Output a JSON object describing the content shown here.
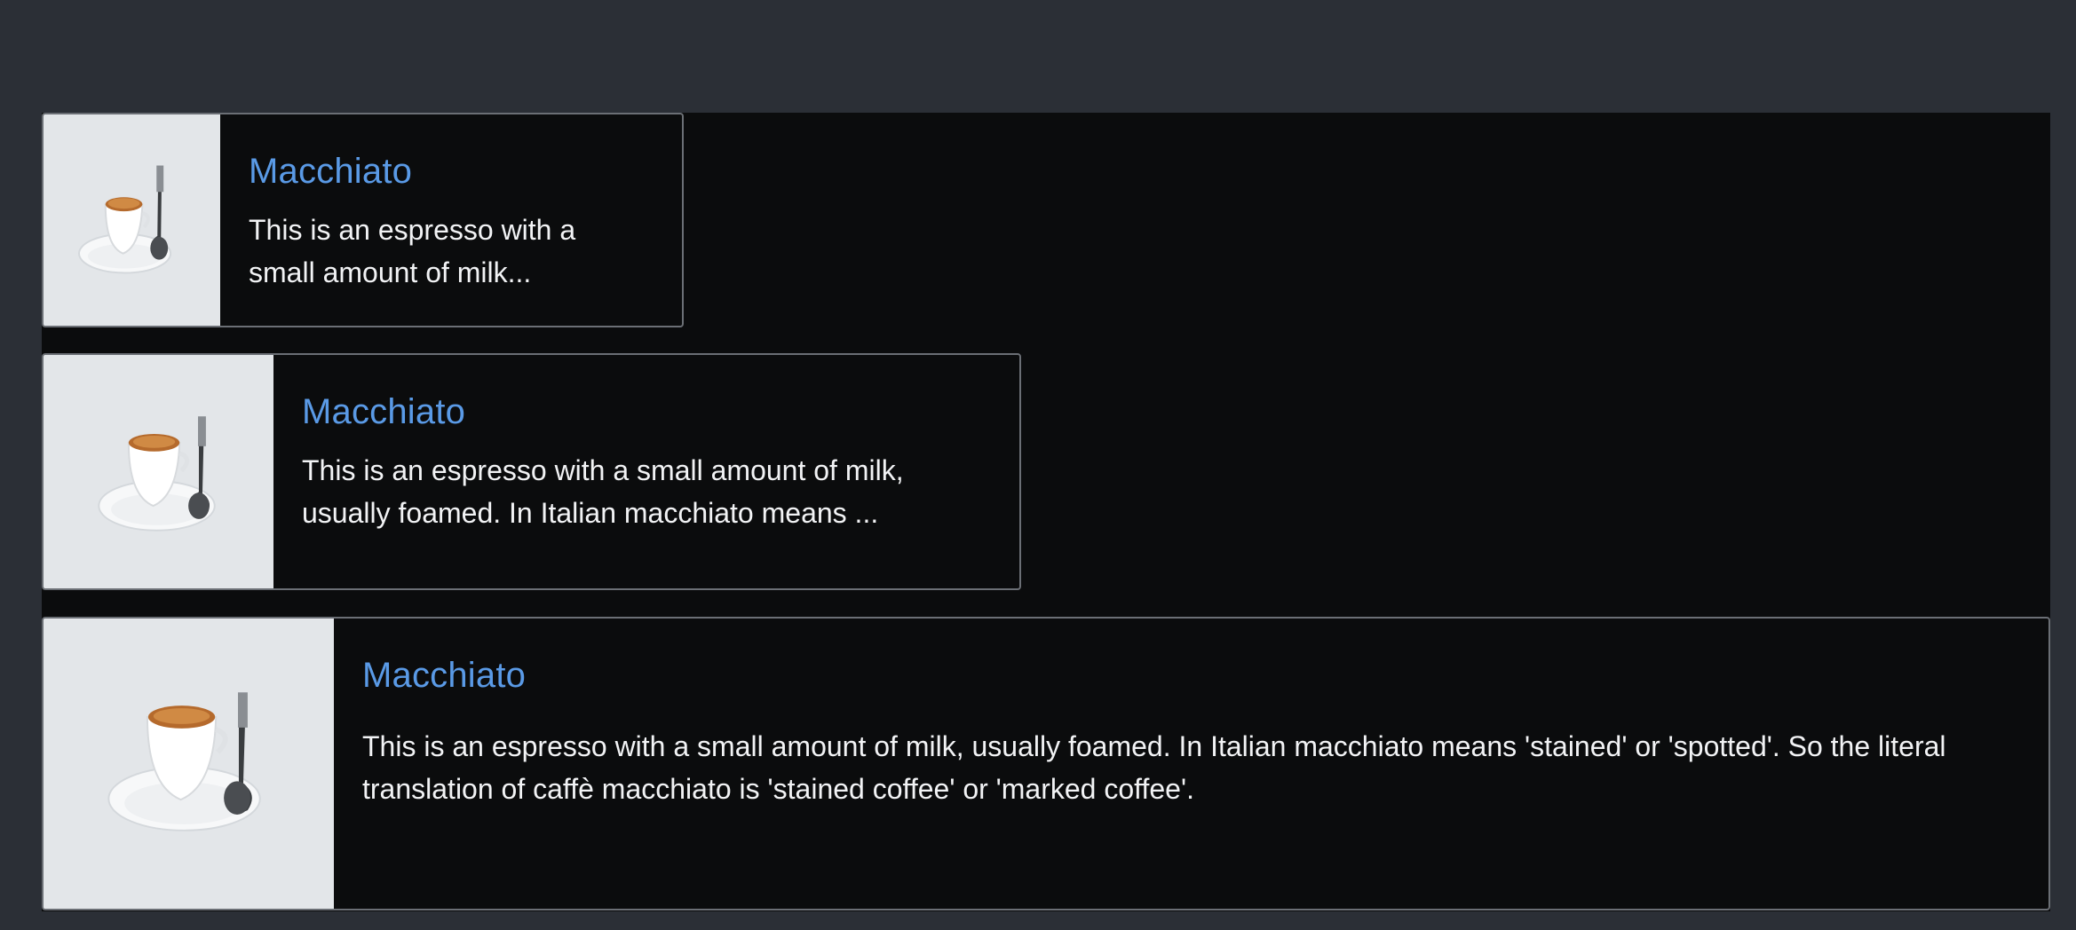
{
  "cards": [
    {
      "title": "Macchiato",
      "text": "This is an espresso with a small amount of milk...",
      "image": "coffee-cup-image"
    },
    {
      "title": "Macchiato",
      "text": "This is an espresso with a small amount of milk, usually foamed. In Italian macchiato means ...",
      "image": "coffee-cup-image"
    },
    {
      "title": "Macchiato",
      "text": "This is an espresso with a small amount of milk, usually foamed. In Italian macchiato means 'stained' or 'spotted'. So the literal translation of caffè macchiato is 'stained coffee' or 'marked coffee'.",
      "image": "coffee-cup-image"
    }
  ],
  "colors": {
    "page_background": "#2b2f36",
    "card_background": "#0b0c0d",
    "card_border": "#6b6f75",
    "title": "#5a9ae6",
    "text": "#f2f3f5",
    "image_background": "#e3e6e9"
  }
}
